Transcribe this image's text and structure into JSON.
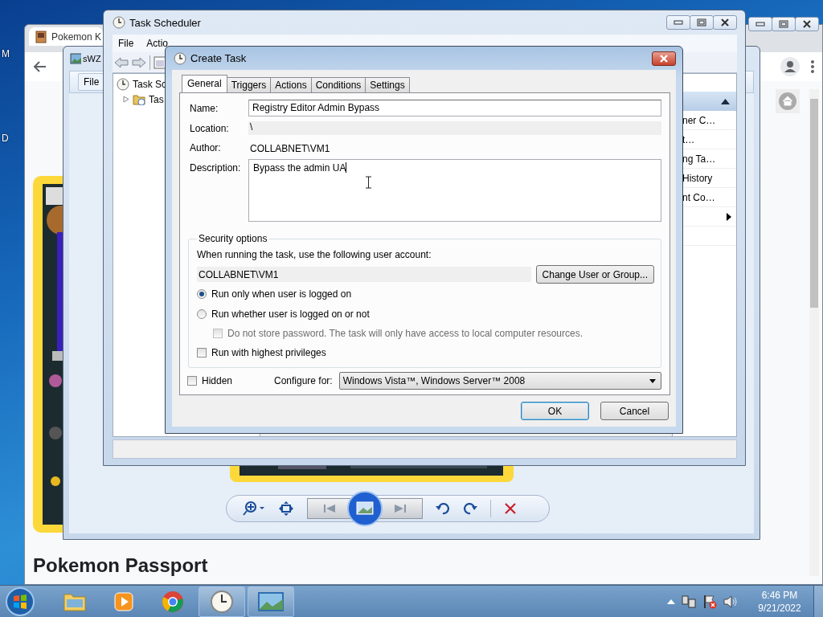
{
  "desktop": {
    "edge_labels": [
      "M",
      "D"
    ]
  },
  "browser": {
    "tab_title": "Pokemon K",
    "page_heading": "Pokemon Passport"
  },
  "photo_viewer": {
    "title": "sWZ",
    "menu": [
      "File"
    ]
  },
  "task_scheduler": {
    "title": "Task Scheduler",
    "menu": [
      "File",
      "Actio"
    ],
    "tree": [
      {
        "label": "Task Sc",
        "children": [
          {
            "label": "Tas",
            "expanded": false
          }
        ]
      }
    ],
    "actions": [
      "ner C…",
      "t…",
      "ng Ta…",
      "History",
      "nt Co…"
    ]
  },
  "dialog": {
    "title": "Create Task",
    "tabs": [
      {
        "label": "General",
        "selected": true
      },
      {
        "label": "Triggers",
        "selected": false
      },
      {
        "label": "Actions",
        "selected": false
      },
      {
        "label": "Conditions",
        "selected": false
      },
      {
        "label": "Settings",
        "selected": false
      }
    ],
    "fields": [
      {
        "kind": "input",
        "label": "Name:",
        "value": "Registry Editor Admin Bypass"
      },
      {
        "kind": "readonly",
        "label": "Location:",
        "value": "\\"
      },
      {
        "kind": "text",
        "label": "Author:",
        "value": "COLLABNET\\VM1"
      },
      {
        "kind": "textarea",
        "label": "Description:",
        "value": "Bypass the admin UA"
      }
    ],
    "security": {
      "title": "Security options",
      "prompt": "When running the task, use the following user account:",
      "account": "COLLABNET\\VM1",
      "change_button": "Change User or Group...",
      "options": [
        {
          "kind": "radio",
          "label": "Run only when user is logged on",
          "selected": true,
          "disabled": false
        },
        {
          "kind": "radio",
          "label": "Run whether user is logged on or not",
          "selected": false,
          "disabled": false,
          "children": [
            {
              "kind": "checkbox",
              "label": "Do not store password.  The task will only have access to local computer resources.",
              "checked": false,
              "disabled": true
            }
          ]
        },
        {
          "kind": "checkbox",
          "label": "Run with highest privileges",
          "checked": false,
          "disabled": false
        }
      ]
    },
    "hidden": {
      "label": "Hidden",
      "checked": false
    },
    "configure": {
      "label": "Configure for:",
      "value": "Windows Vista™, Windows Server™ 2008"
    },
    "buttons": [
      {
        "label": "OK",
        "default": true
      },
      {
        "label": "Cancel",
        "default": false
      }
    ]
  },
  "taskbar": {
    "time": "6:46 PM",
    "date": "9/21/2022"
  }
}
